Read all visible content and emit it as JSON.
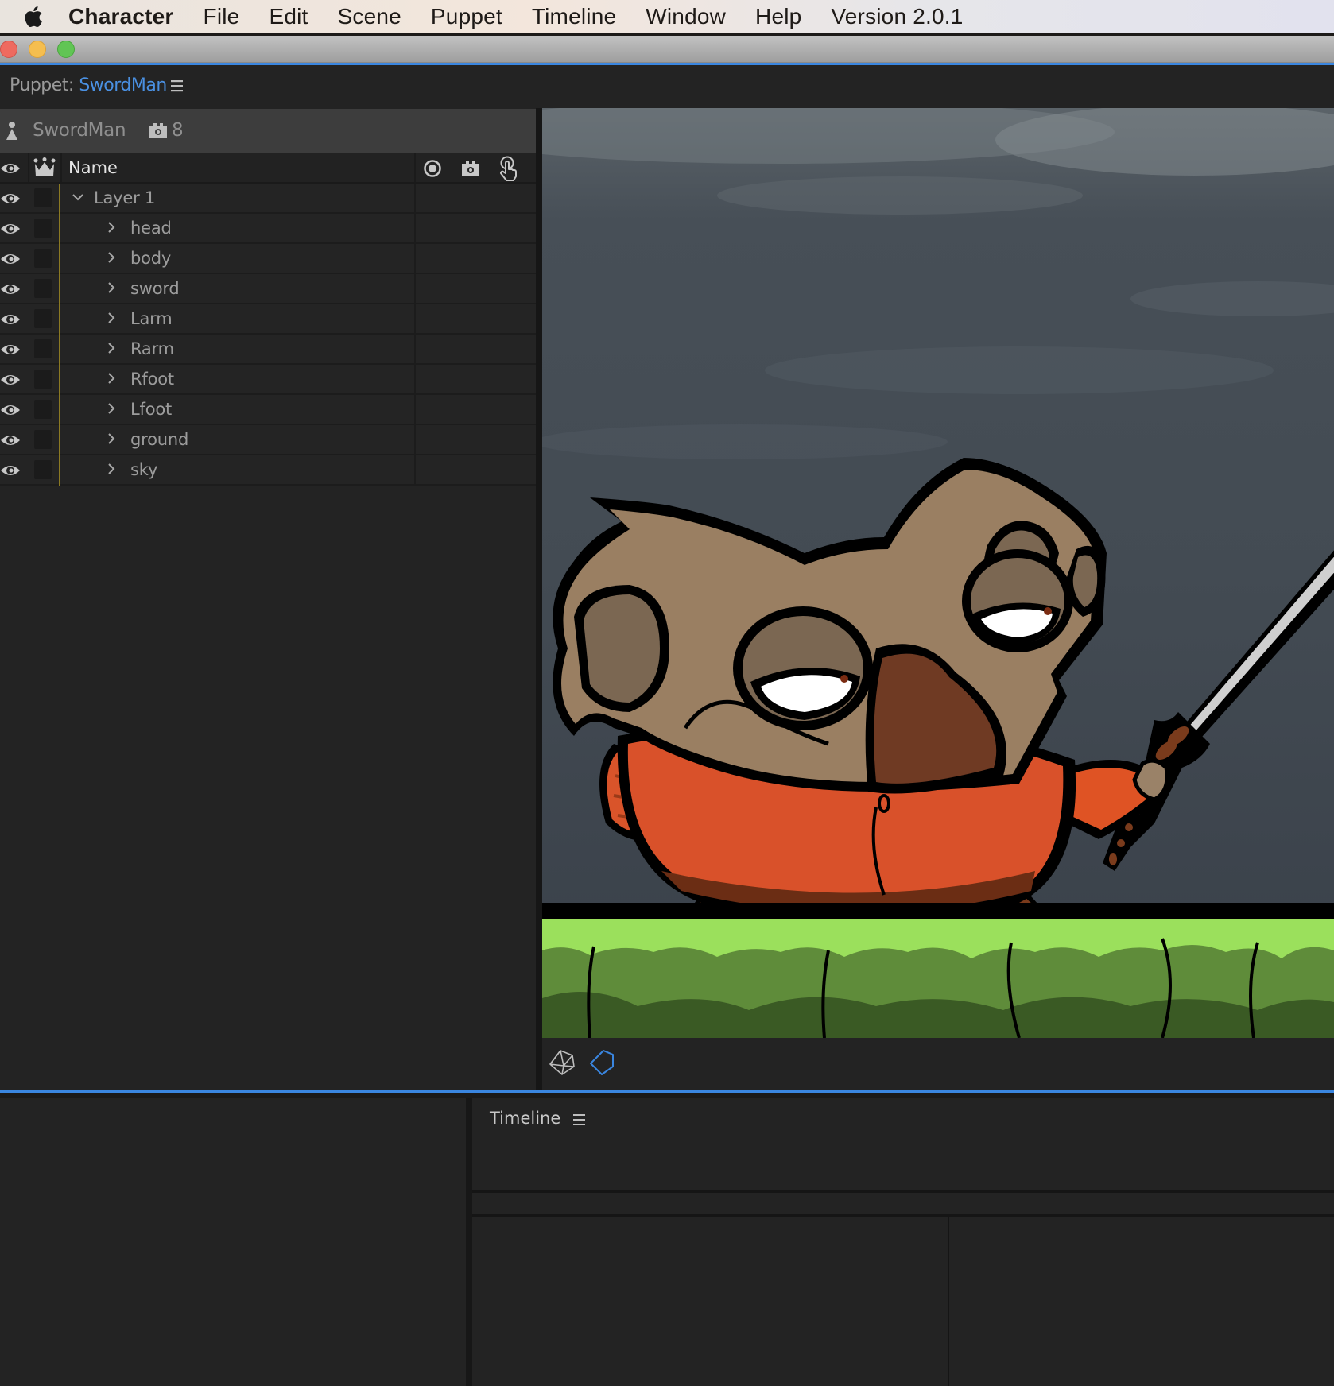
{
  "menubar": {
    "apple_icon": "apple-logo-icon",
    "app_name": "Character",
    "items": [
      "File",
      "Edit",
      "Scene",
      "Puppet",
      "Timeline",
      "Window",
      "Help",
      "Version 2.0.1"
    ]
  },
  "window": {
    "controls": [
      "close",
      "minimize",
      "maximize"
    ]
  },
  "puppet_panel": {
    "prefix": "Puppet: ",
    "puppet_name": "SwordMan",
    "menu_icon": "hamburger-menu-icon"
  },
  "layer_panel": {
    "puppet_bar": {
      "icon": "puppet-figure-icon",
      "name": "SwordMan",
      "handle_icon": "handle-gear-icon",
      "handle_count": "8"
    },
    "header": {
      "visibility_icon": "eye-icon",
      "origin_icon": "crown-icon",
      "name_label": "Name",
      "columns": [
        "record-target-icon",
        "handle-gear-icon",
        "touch-hand-icon"
      ]
    },
    "layers": [
      {
        "label": "Layer 1",
        "depth": 0,
        "expanded": true
      },
      {
        "label": "head",
        "depth": 1,
        "expanded": false
      },
      {
        "label": "body",
        "depth": 1,
        "expanded": false
      },
      {
        "label": "sword",
        "depth": 1,
        "expanded": false
      },
      {
        "label": "Larm",
        "depth": 1,
        "expanded": false
      },
      {
        "label": "Rarm",
        "depth": 1,
        "expanded": false
      },
      {
        "label": "Rfoot",
        "depth": 1,
        "expanded": false
      },
      {
        "label": "Lfoot",
        "depth": 1,
        "expanded": false
      },
      {
        "label": "ground",
        "depth": 1,
        "expanded": false
      },
      {
        "label": "sky",
        "depth": 1,
        "expanded": false
      }
    ]
  },
  "scene": {
    "description": "Cartoon koala-like character in orange shirt holding a sword, on green grass under a stormy grey sky",
    "toolbar": [
      {
        "icon": "mesh-wireframe-icon",
        "active": false
      },
      {
        "icon": "pentagon-outline-icon",
        "active": true
      }
    ]
  },
  "timeline": {
    "title": "Timeline",
    "menu_icon": "hamburger-menu-icon"
  },
  "colors": {
    "accent": "#3a86e0",
    "puppet_name": "#4a90e2",
    "layer_line": "#8c7a23",
    "panel_bg": "#232323"
  }
}
